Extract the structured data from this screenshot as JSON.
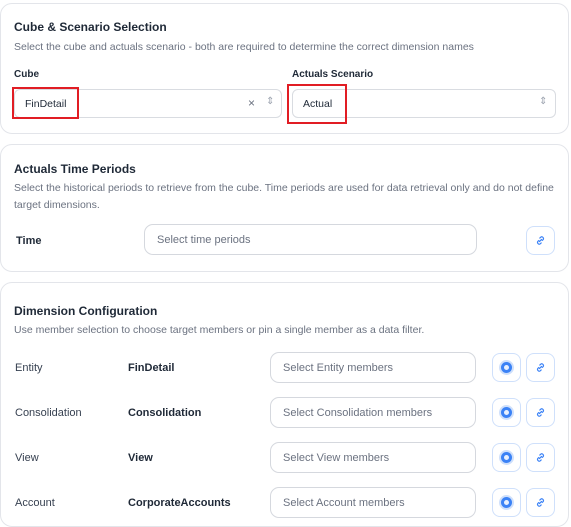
{
  "cube_section": {
    "title": "Cube & Scenario Selection",
    "description": "Select the cube and actuals scenario - both are required to determine the correct dimension names",
    "cube_label": "Cube",
    "cube_value": "FinDetail",
    "clear_glyph": "×",
    "chevron_glyph": "⇕",
    "scenario_label": "Actuals Scenario",
    "scenario_value": "Actual"
  },
  "time_section": {
    "title": "Actuals Time Periods",
    "description": "Select the historical periods to retrieve from the cube. Time periods are used for data retrieval only and do not define target dimensions.",
    "time_label": "Time",
    "time_placeholder": "Select time periods"
  },
  "dimension_section": {
    "title": "Dimension Configuration",
    "description": "Use member selection to choose target members or pin a single member as a data filter.",
    "rows": [
      {
        "dimension": "Entity",
        "member": "FinDetail",
        "placeholder": "Select Entity members"
      },
      {
        "dimension": "Consolidation",
        "member": "Consolidation",
        "placeholder": "Select Consolidation members"
      },
      {
        "dimension": "View",
        "member": "View",
        "placeholder": "Select View members"
      },
      {
        "dimension": "Account",
        "member": "CorporateAccounts",
        "placeholder": "Select Account members"
      }
    ]
  },
  "colors": {
    "accent": "#3b82f6",
    "highlight": "#e11d24",
    "border": "#e3e5ea"
  },
  "icons": {
    "member_select": "target-icon",
    "pin": "link-icon"
  }
}
